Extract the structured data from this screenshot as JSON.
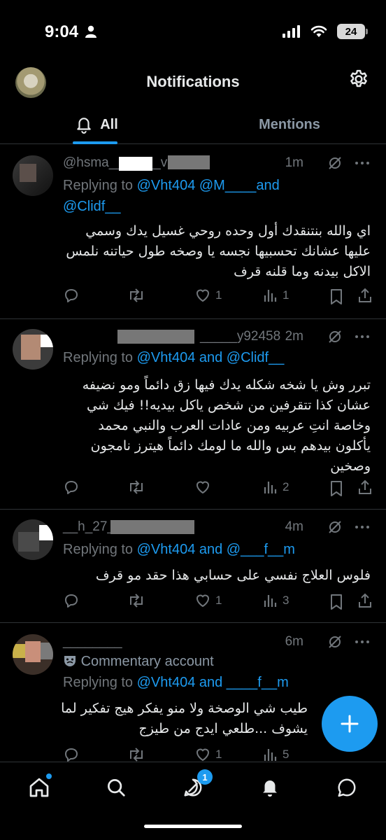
{
  "status_bar": {
    "time": "9:04",
    "battery": "24"
  },
  "header": {
    "title": "Notifications"
  },
  "tabs": [
    {
      "label": "All",
      "active": true
    },
    {
      "label": "Mentions",
      "active": false
    }
  ],
  "posts": [
    {
      "name_visible": "@hsma_______v92458",
      "time": "1m",
      "reply_prefix": "Replying to",
      "reply_handles": "@Vht404 @M____and",
      "reply_line2": "@Clidf__",
      "text": "اي والله بنتنقدك أول وحده روحي غسيل يدك وسمي عليها عشانك تحسبيها نجسه يا وصخه طول حياتنه نلمس الاكل بيدنه وما قلنه قرف",
      "stats": {
        "reply": "",
        "retweet": "",
        "like": "1",
        "views": "1"
      }
    },
    {
      "name_visible": "_____y92458",
      "time": "2m",
      "reply_prefix": "Replying to",
      "reply_handles": "@Vht404 and @Clidf__",
      "text": "تبرر وش يا شخه شكله يدك فيها زق دائماً ومو نضيفه عشان كذا تتقرفين من شخص ياكل بيديه!! فيك شي وخاصة انتِ عربيه ومن عادات العرب والنبي محمد يأكلون بيدهم بس والله ما لومك دائماً هيترز نامجون وصخين",
      "stats": {
        "reply": "",
        "retweet": "",
        "like": "",
        "views": "2"
      }
    },
    {
      "name_visible": "__h_27_______1153",
      "time": "4m",
      "reply_prefix": "Replying to",
      "reply_handles": "@Vht404 and @___f__m",
      "text": "فلوس العلاج نفسي على حسابي هذا حقد مو قرف",
      "stats": {
        "reply": "",
        "retweet": "",
        "like": "1",
        "views": "3"
      }
    },
    {
      "name_visible": "________",
      "time": "6m",
      "commentary": "Commentary account",
      "reply_prefix": "Replying to",
      "reply_handles": "@Vht404 and ____f__m",
      "text": "طيب شي الوصخة ولا منو يفكر هيج تفكير لما يشوف ...طلعي ايدج من طيزج",
      "stats": {
        "reply": "",
        "retweet": "",
        "like": "1",
        "views": "5"
      }
    }
  ],
  "bottom_nav": {
    "notifications_badge": "1"
  },
  "colors": {
    "accent": "#1d9bf0",
    "background": "#000000",
    "muted": "#71767b",
    "text": "#e7e9ea"
  }
}
